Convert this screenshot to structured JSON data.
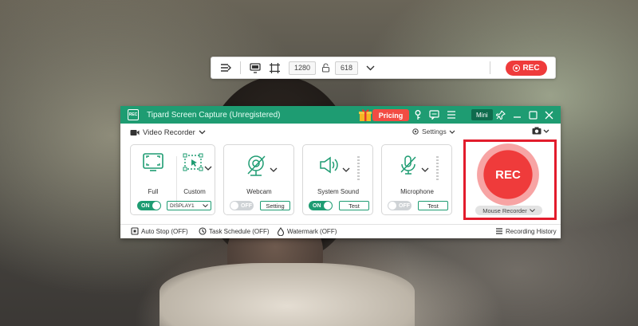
{
  "toolbar": {
    "width_value": "1280",
    "height_value": "618",
    "rec_label": "REC"
  },
  "window": {
    "title": "Tipard Screen Capture (Unregistered)",
    "logo_text": "REC",
    "pricing_label": "Pricing",
    "mini_label": "Mini",
    "mode_label": "Video Recorder",
    "settings_label": "Settings"
  },
  "cards": {
    "area": {
      "full_label": "Full",
      "custom_label": "Custom",
      "toggle": "ON",
      "display_value": "DISPLAY1"
    },
    "webcam": {
      "label": "Webcam",
      "toggle": "OFF",
      "button": "Setting"
    },
    "system_sound": {
      "label": "System Sound",
      "toggle": "ON",
      "button": "Test"
    },
    "microphone": {
      "label": "Microphone",
      "toggle": "OFF",
      "button": "Test"
    }
  },
  "record": {
    "button_label": "REC",
    "mouse_recorder_label": "Mouse Recorder"
  },
  "footer": {
    "auto_stop": "Auto Stop (OFF)",
    "task_schedule": "Task Schedule (OFF)",
    "watermark": "Watermark (OFF)",
    "recording_history": "Recording History"
  },
  "colors": {
    "brand_green": "#1e9c72",
    "rec_red": "#ef3b3b",
    "highlight_red": "#e21c2c"
  }
}
